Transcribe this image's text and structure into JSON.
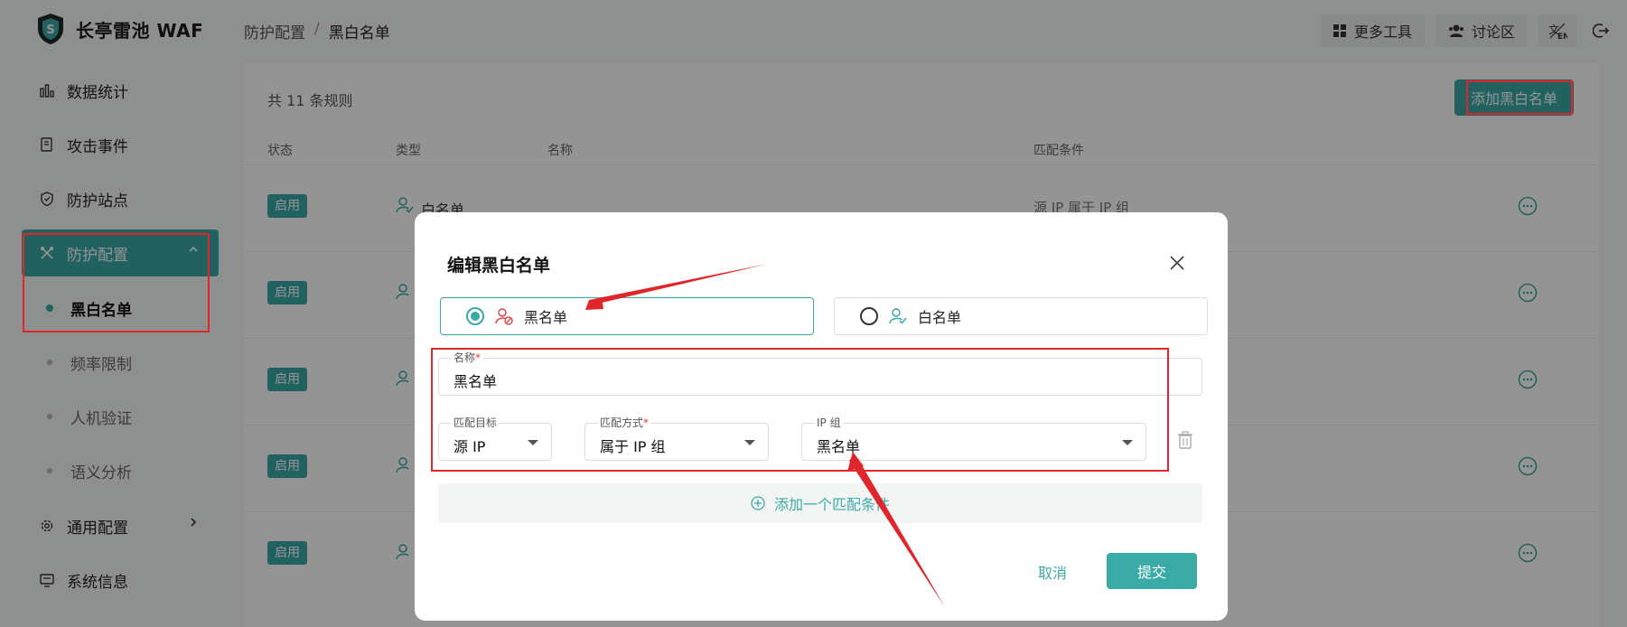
{
  "app": {
    "title": "长亭雷池 WAF"
  },
  "breadcrumb": {
    "parent": "防护配置",
    "separator": "/",
    "current": "黑白名单"
  },
  "top_actions": {
    "more_tools": "更多工具",
    "forum": "讨论区"
  },
  "sidebar": {
    "stats": "数据统计",
    "attacks": "攻击事件",
    "sites": "防护站点",
    "protection_config": "防护配置",
    "blackwhite": "黑白名单",
    "rate_limit": "频率限制",
    "captcha": "人机验证",
    "semantic": "语义分析",
    "general_config": "通用配置",
    "system_info": "系统信息"
  },
  "list": {
    "count_text": "共 11 条规则",
    "add_button": "添加黑白名单",
    "headers": {
      "status": "状态",
      "type": "类型",
      "name": "名称",
      "condition": "匹配条件"
    },
    "rows": [
      {
        "status": "启用",
        "type": "白名单",
        "condition": "源 IP 属于 IP 组"
      },
      {
        "status": "启用"
      },
      {
        "status": "启用"
      },
      {
        "status": "启用"
      },
      {
        "status": "启用"
      }
    ]
  },
  "modal": {
    "title": "编辑黑白名单",
    "option_black": "黑名单",
    "option_white": "白名单",
    "selected": "黑名单",
    "name_label": "名称",
    "name_value": "黑名单",
    "target_label": "匹配目标",
    "target_value": "源 IP",
    "method_label": "匹配方式",
    "method_value": "属于 IP 组",
    "ipgroup_label": "IP 组",
    "ipgroup_value": "黑名单",
    "required_mark": "*",
    "add_condition": "添加一个匹配条件",
    "cancel": "取消",
    "submit": "提交"
  },
  "colors": {
    "accent": "#3aaaa6",
    "annotation": "#e0262a",
    "required": "#e23c3c"
  }
}
